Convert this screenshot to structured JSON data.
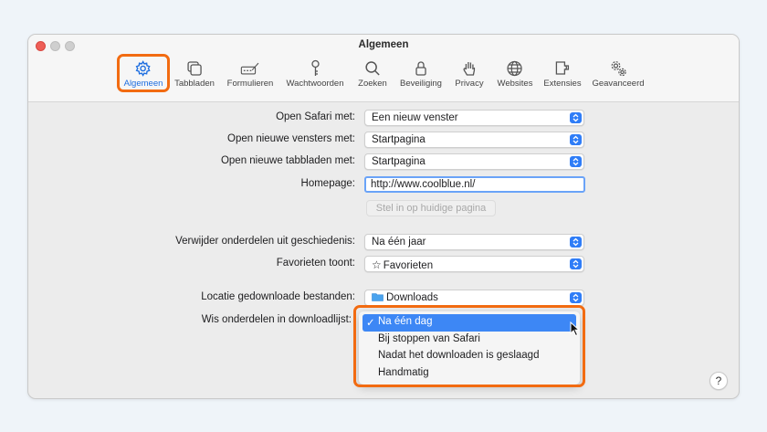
{
  "window": {
    "title": "Algemeen"
  },
  "toolbar": {
    "items": [
      {
        "label": "Algemeen",
        "icon": "gear-icon",
        "active": true
      },
      {
        "label": "Tabbladen",
        "icon": "tabs-icon"
      },
      {
        "label": "Formulieren",
        "icon": "autofill-icon"
      },
      {
        "label": "Wachtwoorden",
        "icon": "key-icon"
      },
      {
        "label": "Zoeken",
        "icon": "search-icon"
      },
      {
        "label": "Beveiliging",
        "icon": "lock-icon"
      },
      {
        "label": "Privacy",
        "icon": "hand-icon"
      },
      {
        "label": "Websites",
        "icon": "globe-icon"
      },
      {
        "label": "Extensies",
        "icon": "puzzle-icon"
      },
      {
        "label": "Geavanceerd",
        "icon": "gears-icon"
      }
    ]
  },
  "form": {
    "open_safari": {
      "label": "Open Safari met:",
      "value": "Een nieuw venster"
    },
    "new_windows": {
      "label": "Open nieuwe vensters met:",
      "value": "Startpagina"
    },
    "new_tabs": {
      "label": "Open nieuwe tabbladen met:",
      "value": "Startpagina"
    },
    "homepage": {
      "label": "Homepage:",
      "value": "http://www.coolblue.nl/"
    },
    "set_current_button": "Stel in op huidige pagina",
    "remove_history": {
      "label": "Verwijder onderdelen uit geschiedenis:",
      "value": "Na één jaar"
    },
    "favorites_shows": {
      "label": "Favorieten toont:",
      "value": "Favorieten"
    },
    "download_location": {
      "label": "Locatie gedownloade bestanden:",
      "value": "Downloads"
    },
    "remove_downloads": {
      "label": "Wis onderdelen in downloadlijst:"
    }
  },
  "dropdown": {
    "options": [
      "Na één dag",
      "Bij stoppen van Safari",
      "Nadat het downloaden is geslaagd",
      "Handmatig"
    ],
    "selected": "Na één dag",
    "check": "✓"
  },
  "help": "?",
  "colors": {
    "accent": "#2f7df7",
    "highlight": "#f26b11",
    "selection": "#3d87f5"
  }
}
